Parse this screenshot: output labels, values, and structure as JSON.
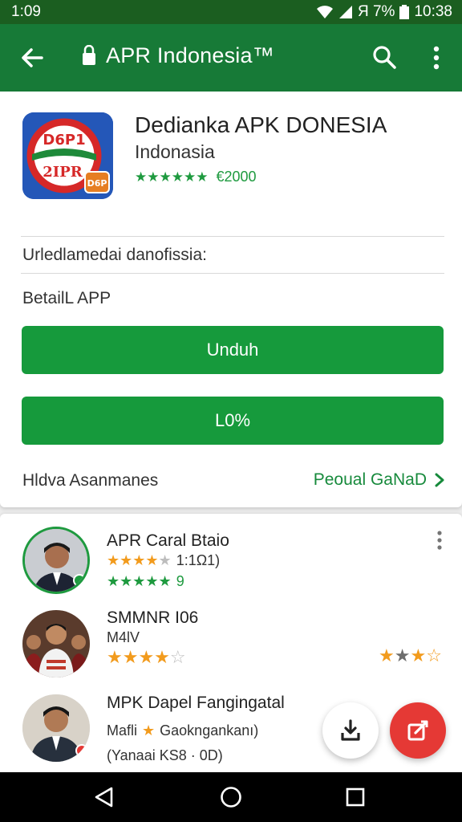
{
  "status_bar": {
    "time": "1:09",
    "battery_text": "Я 7%",
    "clock_right": "10:38"
  },
  "app_bar": {
    "title": "APR Indonesia™",
    "back_icon": "back-arrow-icon",
    "search_icon": "search-icon",
    "more_icon": "more-vert-icon"
  },
  "app": {
    "icon_text_top": "D6P1",
    "icon_text_bottom": "2IPR",
    "icon_badge": "D6P",
    "name": "Dedianka APK DONESIA",
    "subtitle": "Indonasia",
    "rating_stars": "★★★★★★",
    "price": "€2000",
    "description": "Urledlamedai danofissia:",
    "detail_label": "BetailL APP",
    "primary_button": "Unduh",
    "secondary_button": "L0%",
    "footer_label": "Hldva Asanmanes",
    "footer_link": "Peoual GaNaD"
  },
  "reviews": [
    {
      "title": "APR Caral Btaio",
      "line1_stars": "★★★★",
      "line1_empty": "★",
      "line1_text": "1:1Ω1)",
      "line2_stars": "★★★★★",
      "line2_text": "9"
    },
    {
      "title": "SMMNR I06",
      "line1_text": "M4lV",
      "line2_stars": "★★★★",
      "line2_empty": "☆",
      "right_stars_a": "★",
      "right_stars_b": "★",
      "right_stars_c": "★",
      "right_stars_d": "☆"
    },
    {
      "title": "MPK Dapel Fangingatal",
      "line1_text_a": "Mafli",
      "line1_text_b": "Gaokngankanı)",
      "line2_text": "(Yanaai KS8 · 0D)"
    }
  ],
  "colors": {
    "primary": "#177a37",
    "status": "#1b5e20",
    "button": "#169a3c",
    "fab_red": "#e53935"
  }
}
